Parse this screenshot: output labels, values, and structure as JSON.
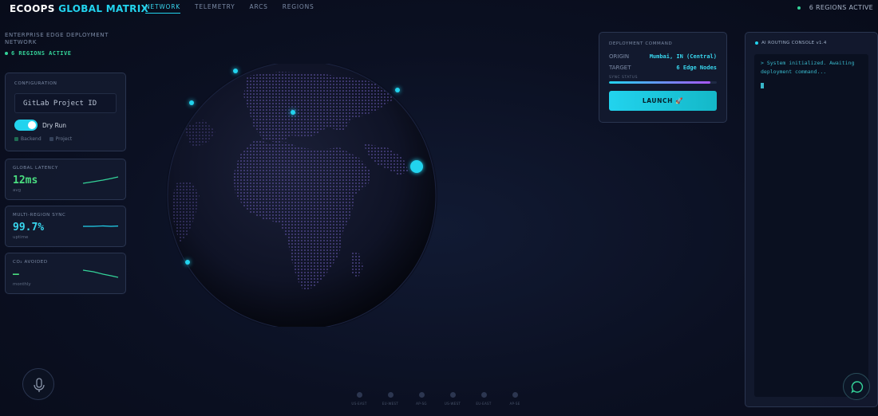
{
  "header": {
    "brand_prefix": "ECOOPS",
    "brand_accent": "GLOBAL MATRIX",
    "tabs": [
      {
        "label": "NETWORK",
        "active": true
      },
      {
        "label": "TELEMETRY",
        "active": false
      },
      {
        "label": "ARCS",
        "active": false
      },
      {
        "label": "REGIONS",
        "active": false
      }
    ],
    "status": "6 REGIONS ACTIVE"
  },
  "left": {
    "title": "ENTERPRISE EDGE DEPLOYMENT NETWORK",
    "regions_badge": "6 REGIONS ACTIVE",
    "config": {
      "title": "CONFIGURATION",
      "gitlab_label": "GitLab Project ID",
      "dry_run_label": "Dry Run",
      "dry_run_on": true,
      "checks": [
        "Backend",
        "Project"
      ]
    },
    "metrics": [
      {
        "title": "GLOBAL LATENCY",
        "value": "12ms",
        "sub": "avg",
        "color": "#4ade80"
      },
      {
        "title": "MULTI-REGION SYNC",
        "value": "99.7%",
        "sub": "uptime",
        "color": "#38d6ee"
      },
      {
        "title": "CO₂ AVOIDED",
        "value": "—",
        "sub": "monthly",
        "color": "#4ade80"
      }
    ]
  },
  "deploy": {
    "title": "DEPLOYMENT COMMAND",
    "origin_label": "ORIGIN",
    "origin_value": "Mumbai, IN (Central)",
    "target_label": "TARGET",
    "target_value": "6 Edge Nodes",
    "sync_label": "SYNC STATUS",
    "sync_progress": 0.94,
    "launch_label": "LAUNCH 🚀"
  },
  "console": {
    "title": "AI ROUTING CONSOLE v1.4",
    "lines": [
      "> System initialized. Awaiting",
      "deployment command..."
    ]
  },
  "regions": [
    "US-EAST",
    "EU-WEST",
    "AP-SG",
    "US-WEST",
    "EU-EAST",
    "AP-SE"
  ],
  "colors": {
    "accent": "#22d3ee",
    "success": "#34d399",
    "panel_bg": "#141b30",
    "page_bg": "#0b1022"
  },
  "icons": {
    "mic": "microphone-icon",
    "chat": "chat-bubble-icon",
    "rocket": "rocket-icon"
  }
}
